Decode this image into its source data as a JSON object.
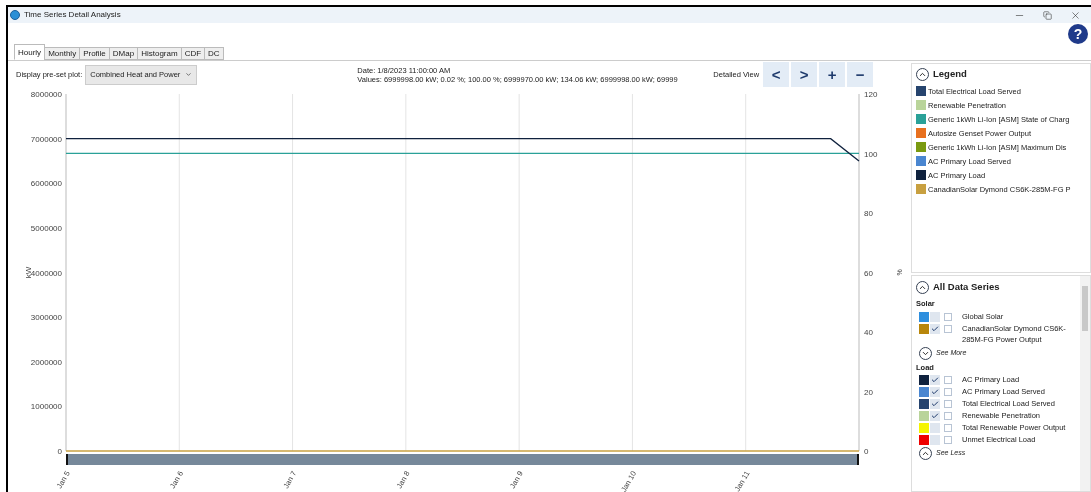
{
  "window": {
    "title": "Time Series Detail Analysis",
    "help": "?"
  },
  "tabs": [
    {
      "label": "Hourly",
      "selected": true
    },
    {
      "label": "Monthly",
      "selected": false
    },
    {
      "label": "Profile",
      "selected": false
    },
    {
      "label": "DMap",
      "selected": false
    },
    {
      "label": "Histogram",
      "selected": false
    },
    {
      "label": "CDF",
      "selected": false
    },
    {
      "label": "DC",
      "selected": false
    }
  ],
  "toolbar": {
    "preset_label": "Display pre-set plot:",
    "preset_value": "Combined Heat and Power",
    "date": "Date:  1/8/2023 11:00:00 AM",
    "values": "Values:  6999998.00 kW; 0.02 %; 100.00 %; 6999970.00 kW; 134.06 kW; 6999998.00 kW; 69999",
    "detailed_view": "Detailed View",
    "buttons": [
      "<",
      ">",
      "+",
      "−"
    ]
  },
  "chart": {
    "right_axis": {
      "label": "%",
      "ticks": [
        "120",
        "100",
        "80",
        "60",
        "40",
        "20",
        "0"
      ]
    },
    "chart_data": {
      "type": "line",
      "ylabel": "kW",
      "ylim": [
        0,
        8000000
      ],
      "yticks": [
        {
          "value": 0,
          "label": "0"
        },
        {
          "value": 1000000,
          "label": "1000000"
        },
        {
          "value": 2000000,
          "label": "2000000"
        },
        {
          "value": 3000000,
          "label": "3000000"
        },
        {
          "value": 4000000,
          "label": "4000000"
        },
        {
          "value": 5000000,
          "label": "5000000"
        },
        {
          "value": 6000000,
          "label": "6000000"
        },
        {
          "value": 7000000,
          "label": "7000000"
        },
        {
          "value": 8000000,
          "label": "8000000"
        }
      ],
      "categories": [
        "Jan 5",
        null,
        null,
        null,
        "Jan 6",
        null,
        null,
        null,
        "Jan 7",
        null,
        null,
        null,
        "Jan 8",
        null,
        null,
        null,
        "Jan 9",
        null,
        null,
        null,
        "Jan 10",
        null,
        null,
        null,
        "Jan 11",
        null,
        null,
        null,
        null
      ],
      "grid": true,
      "series": [
        {
          "name": "Total Electrical Load Served",
          "color": "#26446e",
          "values": [
            null,
            null,
            null,
            null,
            null,
            null,
            null,
            null,
            null,
            null,
            null,
            null,
            null,
            null,
            null,
            null,
            null,
            null,
            null,
            null,
            null,
            null,
            null,
            null,
            null,
            null,
            null,
            null,
            null
          ]
        },
        {
          "name": "Renewable Penetration",
          "color": "#b9d49a",
          "values": [
            null,
            null,
            null,
            null,
            null,
            null,
            null,
            null,
            null,
            null,
            null,
            null,
            null,
            null,
            null,
            null,
            null,
            null,
            null,
            null,
            null,
            null,
            null,
            null,
            null,
            null,
            null,
            null,
            null
          ]
        },
        {
          "name": "Generic 1kWh Li-Ion [ASM] State of Charg",
          "color": "#2aa198",
          "values": [
            6670000,
            6670000,
            6670000,
            6670000,
            6670000,
            6670000,
            6670000,
            6670000,
            6670000,
            6670000,
            6670000,
            6670000,
            6670000,
            6670000,
            6670000,
            6670000,
            6670000,
            6670000,
            6670000,
            6670000,
            6670000,
            6670000,
            6670000,
            6670000,
            6670000,
            6670000,
            6670000,
            6670000,
            6670000
          ]
        },
        {
          "name": "Autosize Genset Power Output",
          "color": "#e8701e",
          "values": [
            null,
            null,
            null,
            null,
            null,
            null,
            null,
            null,
            null,
            null,
            null,
            null,
            null,
            null,
            null,
            null,
            null,
            null,
            null,
            null,
            null,
            null,
            null,
            null,
            null,
            null,
            null,
            null,
            null
          ]
        },
        {
          "name": "Generic 1kWh Li-Ion [ASM] Maximum Dis",
          "color": "#7a9a10",
          "values": [
            null,
            null,
            null,
            null,
            null,
            null,
            null,
            null,
            null,
            null,
            null,
            null,
            null,
            null,
            null,
            null,
            null,
            null,
            null,
            null,
            null,
            null,
            null,
            null,
            null,
            null,
            null,
            null,
            null
          ]
        },
        {
          "name": "AC Primary Load Served",
          "color": "#4a86d0",
          "values": [
            null,
            null,
            null,
            null,
            null,
            null,
            null,
            null,
            null,
            null,
            null,
            null,
            null,
            null,
            null,
            null,
            null,
            null,
            null,
            null,
            null,
            null,
            null,
            null,
            null,
            null,
            null,
            null,
            null
          ]
        },
        {
          "name": "AC Primary Load",
          "color": "#10223e",
          "values": [
            7000000,
            7000000,
            7000000,
            7000000,
            7000000,
            7000000,
            7000000,
            7000000,
            7000000,
            7000000,
            7000000,
            7000000,
            7000000,
            7000000,
            7000000,
            7000000,
            7000000,
            7000000,
            7000000,
            7000000,
            7000000,
            7000000,
            7000000,
            7000000,
            7000000,
            7000000,
            7000000,
            7000000,
            6500000
          ]
        },
        {
          "name": "CanadianSolar Dymond CS6K-285M-FG P",
          "color": "#c8a040",
          "values": [
            0,
            0,
            0,
            0,
            0,
            0,
            0,
            0,
            0,
            0,
            0,
            0,
            0,
            0,
            0,
            0,
            0,
            0,
            0,
            0,
            0,
            0,
            0,
            0,
            0,
            0,
            0,
            0,
            0
          ]
        }
      ]
    }
  },
  "legend": {
    "title": "Legend",
    "expanded": true
  },
  "data_series": {
    "title": "All Data Series",
    "expanded": true,
    "groups": [
      {
        "name": "Solar",
        "items": [
          {
            "label": "Global Solar",
            "color": "#2e8fde",
            "checked": false,
            "right_axis": false
          },
          {
            "label": "CanadianSolar Dymond CS6K-285M-FG Power Output",
            "color": "#b8860b",
            "checked": true,
            "right_axis": false
          }
        ],
        "toggle": {
          "label": "See More",
          "expanded": false
        }
      },
      {
        "name": "Load",
        "items": [
          {
            "label": "AC Primary Load",
            "color": "#10223e",
            "checked": true,
            "right_axis": false
          },
          {
            "label": "AC Primary Load Served",
            "color": "#4a86d0",
            "checked": true,
            "right_axis": false
          },
          {
            "label": "Total Electrical Load Served",
            "color": "#26446e",
            "checked": true,
            "right_axis": false
          },
          {
            "label": "Renewable Penetration",
            "color": "#b9d49a",
            "checked": true,
            "right_axis": false
          },
          {
            "label": "Total Renewable Power Output",
            "color": "#f5f500",
            "checked": false,
            "right_axis": false
          },
          {
            "label": "Unmet Electrical Load",
            "color": "#ee0000",
            "checked": false,
            "right_axis": false
          }
        ],
        "toggle": {
          "label": "See Less",
          "expanded": true
        }
      }
    ]
  }
}
